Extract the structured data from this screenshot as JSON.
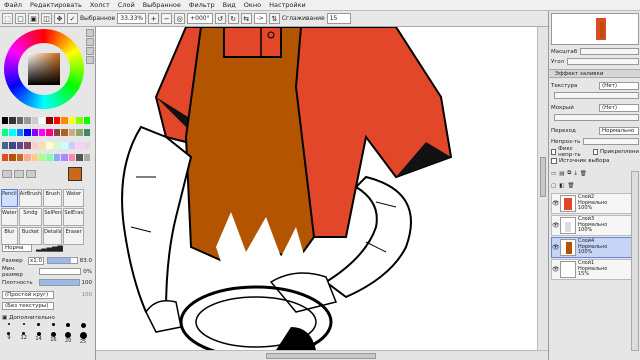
{
  "menu": [
    "Файл",
    "Редактировать",
    "Холст",
    "Слой",
    "Выбранное",
    "Фильтр",
    "Вид",
    "Окно",
    "Настройки"
  ],
  "toolbar": {
    "selected_label": "Выбранное",
    "zoom": "33.33%",
    "rotation": "+000°",
    "arrow": "->",
    "smoothing_label": "Сглаживание",
    "smoothing_value": "15"
  },
  "left": {
    "tools": [
      "Pencil",
      "AirBrush",
      "Brush",
      "Water",
      "Water",
      "Smdg",
      "SelPen",
      "SelEras",
      "Blur",
      "Bucket",
      "Details",
      "Eraser"
    ],
    "mode": "Норма",
    "size_label": "Размер",
    "size_mult": "x1.0",
    "size_value": "83.0",
    "min_size_label": "Мин. размер",
    "min_size_value": "0%",
    "density_label": "Плотность",
    "density_value": "100",
    "shape": "(Простой круг)",
    "texture": "(Без текстуры)",
    "shape_value": "100",
    "extra_label": "Дополнительно",
    "brush_sizes": [
      "9",
      "12",
      "14",
      "16",
      "20",
      "25"
    ]
  },
  "right": {
    "scale_label": "Масштаб",
    "angle_label": "Угол",
    "fill_effect_label": "Эффект заливки",
    "texture_label": "Текстура",
    "texture_value": "(Нет)",
    "wet_label": "Мокрый",
    "wet_value": "(Нет)",
    "blend_label": "Переход",
    "blend_value": "Нормально",
    "opacity_label": "Непроз-ть",
    "fix_opacity_label": "Фикс непр-ть",
    "clip_label": "Прикреплени",
    "source_label": "Источник выбора",
    "layers": [
      {
        "name": "Слой2",
        "mode": "Нормально",
        "opacity": "100%",
        "selected": false
      },
      {
        "name": "Слой3",
        "mode": "Нормально",
        "opacity": "100%",
        "selected": false
      },
      {
        "name": "Слой4",
        "mode": "Нормально",
        "opacity": "100%",
        "selected": true
      },
      {
        "name": "Слой1",
        "mode": "Нормально",
        "opacity": "15%",
        "selected": false
      }
    ]
  },
  "colors": {
    "accent": "#c86a1a",
    "shirt": "#e2472a",
    "apron": "#b35500"
  }
}
